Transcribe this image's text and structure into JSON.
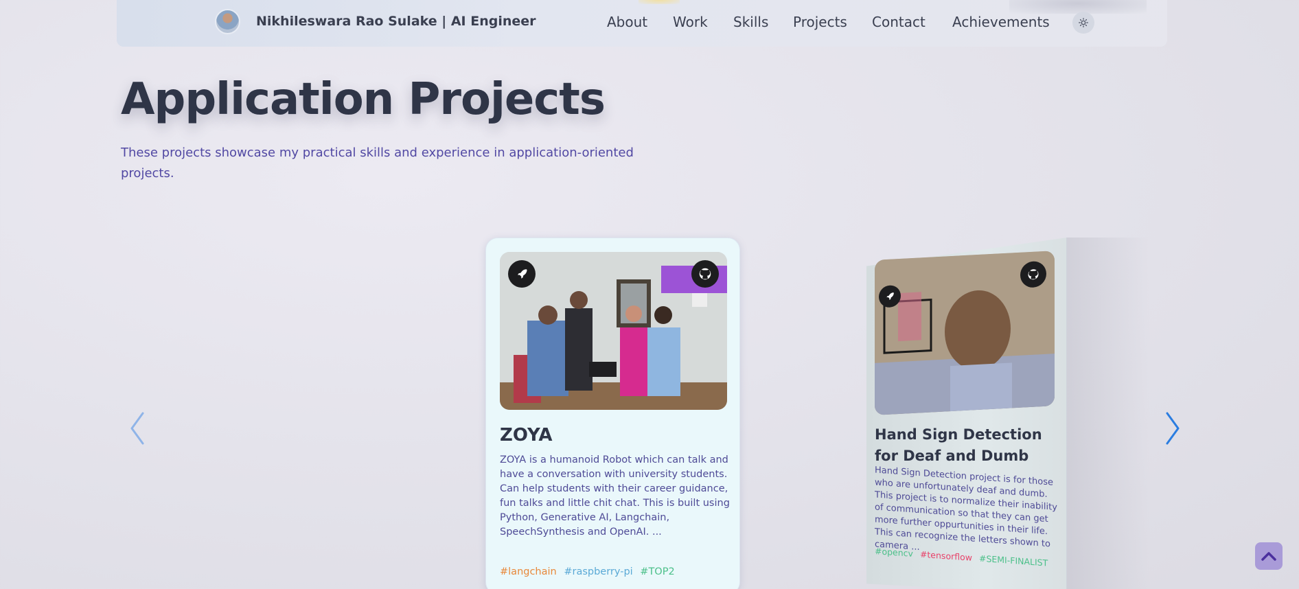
{
  "header": {
    "brand": "Nikhileswara Rao Sulake  | AI Engineer",
    "nav": [
      "About",
      "Work",
      "Skills",
      "Projects",
      "Contact",
      "Achievements"
    ],
    "theme_icon": "sun-icon"
  },
  "section": {
    "title": "Application Projects",
    "description": "These projects showcase my practical skills and experience in application-oriented projects."
  },
  "carousel": {
    "cards": [
      {
        "title": "ZOYA",
        "description": "ZOYA is a humanoid Robot which can talk and have a conversation with university students. Can help students with their career guidance, fun talks and little chit chat. This is built using Python, Generative AI, Langchain, SpeechSynthesis and OpenAI. ...",
        "tags": [
          "#langchain",
          "#raspberry-pi",
          "#TOP2"
        ],
        "tag_colors": [
          "#e8883a",
          "#5aa9d6",
          "#4cc08a"
        ]
      },
      {
        "title": "Hand Sign Detection for Deaf and Dumb",
        "description": "Hand Sign Detection project is for those who are unfortunately deaf and dumb. This project is to normalize their inability of communication so that they can get more further oppurtunities in their life. This can recognize the letters shown to camera ...",
        "tags": [
          "#opencv",
          "#tensorflow",
          "#SEMI-FINALIST"
        ],
        "tag_colors": [
          "#4cc08a",
          "#e8436a",
          "#4cc08a"
        ]
      }
    ]
  },
  "colors": {
    "accent": "#5148a3",
    "arrow": "#2b7de0",
    "back_to_top": "#a99bd8"
  }
}
